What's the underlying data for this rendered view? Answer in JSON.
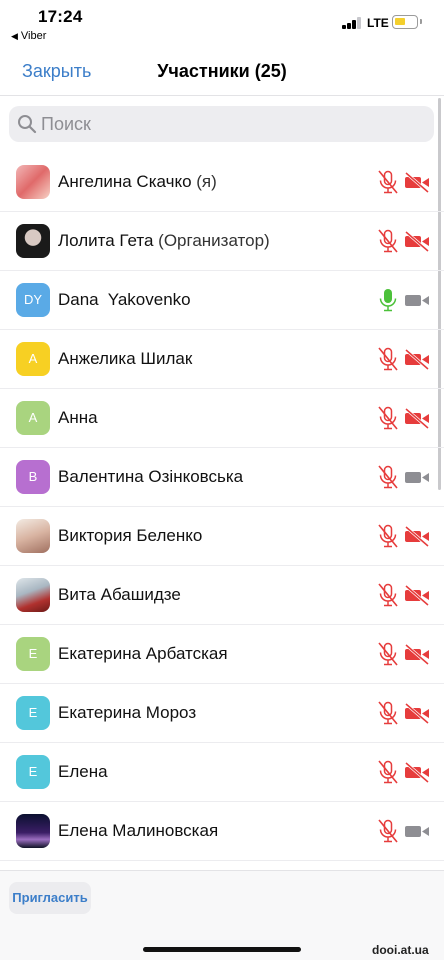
{
  "status_bar": {
    "time": "17:24",
    "back_app": "Viber",
    "network": "LTE",
    "battery_color": "#f4cf2c"
  },
  "nav": {
    "close_label": "Закрыть",
    "title": "Участники (25)"
  },
  "search": {
    "placeholder": "Поиск"
  },
  "colors": {
    "accent": "#3c7ec9",
    "muted_red": "#e63c3c",
    "active_green": "#4cc13a",
    "cam_off_grey": "#8e8e93"
  },
  "participants": [
    {
      "name": "Ангелина Скачко",
      "suffix": " (я)",
      "avatar": {
        "type": "photo",
        "style": "photo-1"
      },
      "mic": "muted",
      "camera": "off"
    },
    {
      "name": "Лолита Гета",
      "suffix": " (Организатор)",
      "avatar": {
        "type": "photo",
        "style": "photo-2"
      },
      "mic": "muted",
      "camera": "off"
    },
    {
      "name": "Dana  Yakovenko",
      "suffix": "",
      "avatar": {
        "type": "initials",
        "initials": "DY",
        "color": "#5aaae6"
      },
      "mic": "active",
      "camera": "grey"
    },
    {
      "name": "Анжелика Шилак",
      "suffix": "",
      "avatar": {
        "type": "initials",
        "initials": "A",
        "color": "#f7d023"
      },
      "mic": "muted",
      "camera": "off"
    },
    {
      "name": "Анна",
      "suffix": "",
      "avatar": {
        "type": "initials",
        "initials": "A",
        "color": "#a9d47f"
      },
      "mic": "muted",
      "camera": "off"
    },
    {
      "name": "Валентина Озінковська",
      "suffix": "",
      "avatar": {
        "type": "initials",
        "initials": "B",
        "color": "#b76fd0"
      },
      "mic": "muted",
      "camera": "grey"
    },
    {
      "name": "Виктория Беленко",
      "suffix": "",
      "avatar": {
        "type": "photo",
        "style": "photo-3"
      },
      "mic": "muted",
      "camera": "off"
    },
    {
      "name": "Вита Абашидзе",
      "suffix": "",
      "avatar": {
        "type": "photo",
        "style": "photo-4"
      },
      "mic": "muted",
      "camera": "off"
    },
    {
      "name": "Екатерина Арбатская",
      "suffix": "",
      "avatar": {
        "type": "initials",
        "initials": "E",
        "color": "#a9d47f"
      },
      "mic": "muted",
      "camera": "off"
    },
    {
      "name": "Екатерина Мороз",
      "suffix": "",
      "avatar": {
        "type": "initials",
        "initials": "E",
        "color": "#53c7db"
      },
      "mic": "muted",
      "camera": "off"
    },
    {
      "name": "Елена",
      "suffix": "",
      "avatar": {
        "type": "initials",
        "initials": "E",
        "color": "#53c7db"
      },
      "mic": "muted",
      "camera": "off"
    },
    {
      "name": "Елена Малиновская",
      "suffix": "",
      "avatar": {
        "type": "photo",
        "style": "photo-5"
      },
      "mic": "muted",
      "camera": "grey"
    }
  ],
  "bottom": {
    "invite_label": "Пригласить",
    "watermark": "dooi.at.ua"
  }
}
